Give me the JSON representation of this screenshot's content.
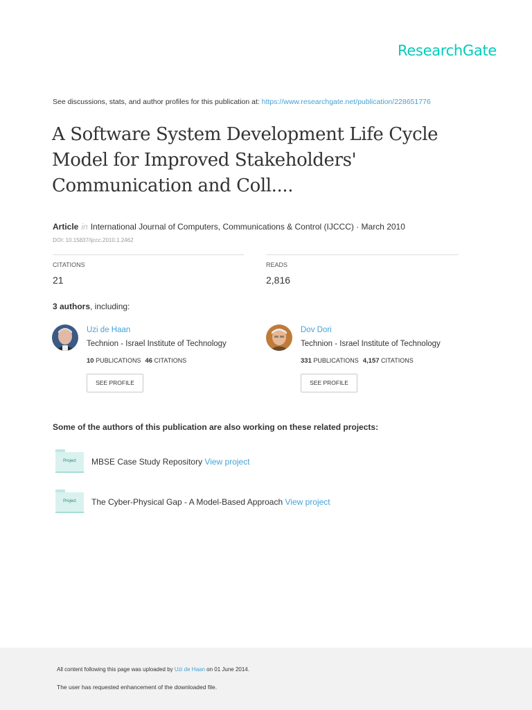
{
  "brand": {
    "logo_text": "ResearchGate",
    "accent_color": "#00ccbb",
    "link_color": "#44a3d5"
  },
  "intro": {
    "text": "See discussions, stats, and author profiles for this publication at: ",
    "url": "https://www.researchgate.net/publication/228651776"
  },
  "article": {
    "title": "A Software System Development Life Cycle Model for Improved Stakeholders' Communication and Coll....",
    "type": "Article",
    "in_word": "in",
    "journal_line": "International Journal of Computers, Communications & Control (IJCCC) · March 2010",
    "doi": "DOI: 10.15837/ijccc.2010.1.2462"
  },
  "stats": {
    "citations_label": "CITATIONS",
    "citations_value": "21",
    "reads_label": "READS",
    "reads_value": "2,816"
  },
  "authors_section": {
    "count": "3 authors",
    "suffix": ", including:"
  },
  "authors": [
    {
      "name": "Uzi de Haan",
      "institution": "Technion - Israel Institute of Technology",
      "publications": "10",
      "publications_label": "PUBLICATIONS",
      "citations": "46",
      "citations_label": "CITATIONS",
      "button": "SEE PROFILE"
    },
    {
      "name": "Dov Dori",
      "institution": "Technion - Israel Institute of Technology",
      "publications": "331",
      "publications_label": "PUBLICATIONS",
      "citations": "4,157",
      "citations_label": "CITATIONS",
      "button": "SEE PROFILE"
    }
  ],
  "related": {
    "heading": "Some of the authors of this publication are also working on these related projects:",
    "projects": [
      {
        "badge": "Project",
        "title": "MBSE Case Study Repository ",
        "link": "View project"
      },
      {
        "badge": "Project",
        "title": "The Cyber-Physical Gap - A Model-Based Approach ",
        "link": "View project"
      }
    ]
  },
  "footer": {
    "upload_prefix": "All content following this page was uploaded by ",
    "uploader": "Uzi de Haan",
    "upload_suffix": " on 01 June 2014.",
    "note": "The user has requested enhancement of the downloaded file."
  }
}
